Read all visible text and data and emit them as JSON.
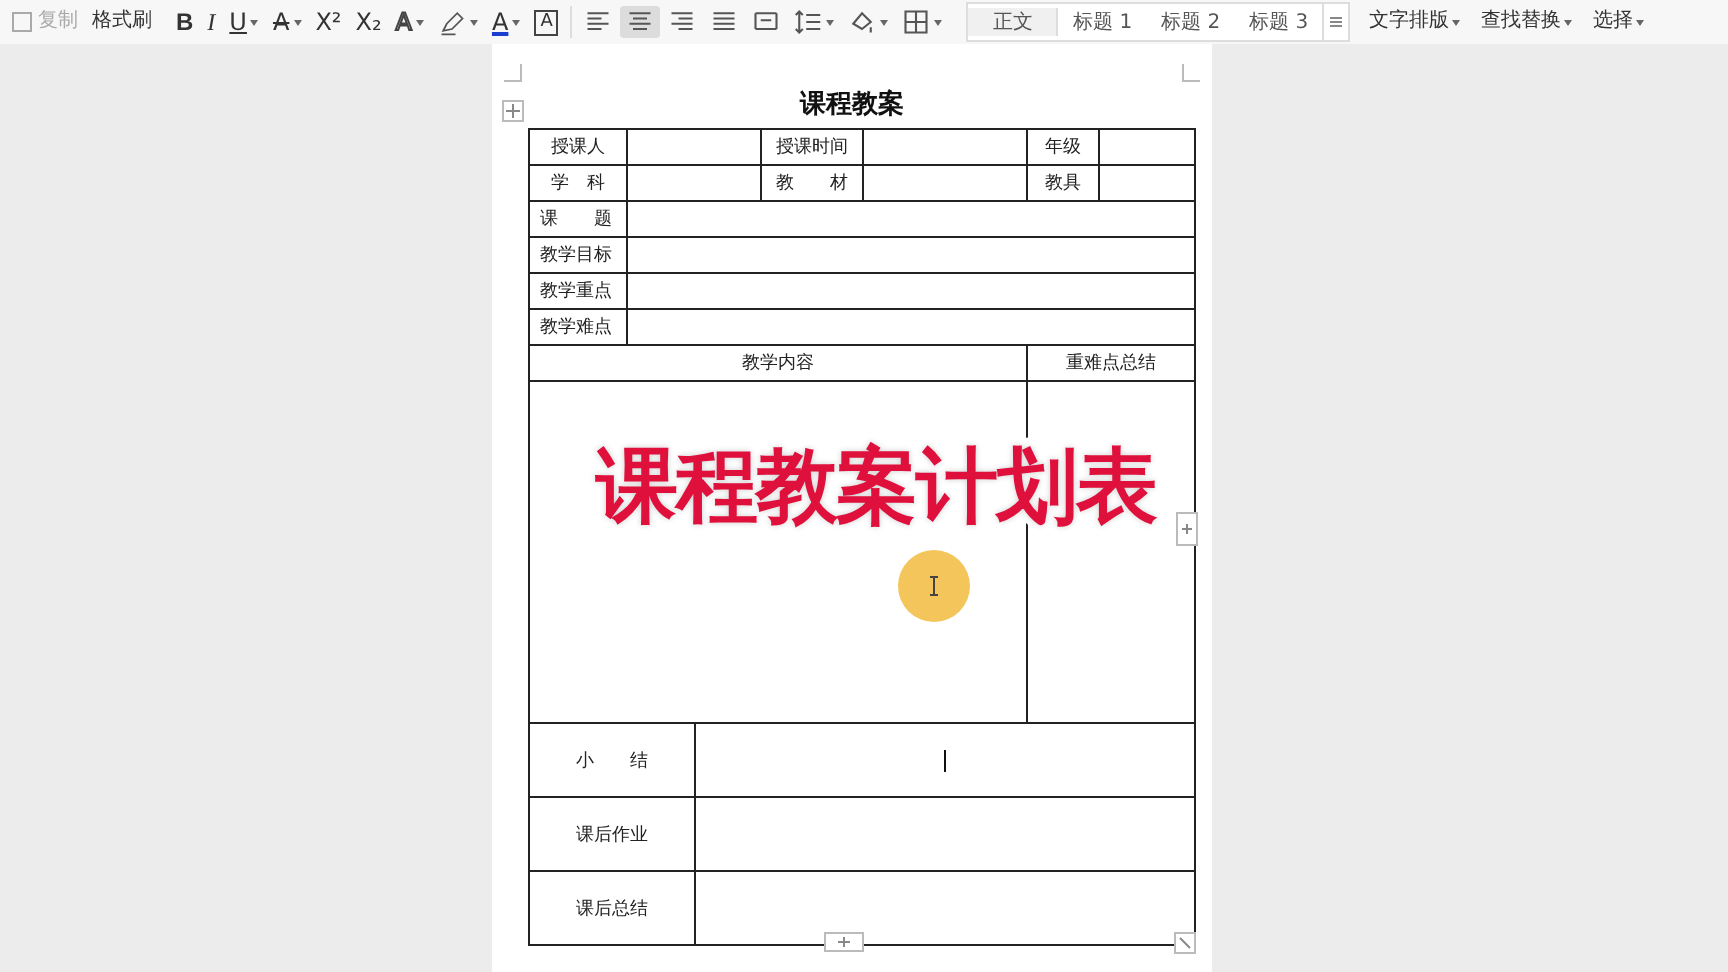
{
  "toolbar": {
    "clipboard": [
      {
        "label": "复制",
        "disabled": true
      },
      {
        "label": "格式刷",
        "disabled": false
      }
    ],
    "format": [
      {
        "kind": "bold",
        "label": "B",
        "dropdown": false
      },
      {
        "kind": "italic",
        "label": "I",
        "dropdown": false
      },
      {
        "kind": "underline",
        "label": "U",
        "dropdown": true
      },
      {
        "kind": "strike",
        "label": "A",
        "dropdown": true
      },
      {
        "kind": "sup",
        "label": "X²",
        "dropdown": false
      },
      {
        "kind": "sub",
        "label": "X₂",
        "dropdown": false
      },
      {
        "kind": "effect",
        "label": "A",
        "dropdown": true
      },
      {
        "kind": "highlight",
        "dropdown": true
      },
      {
        "kind": "color",
        "label": "A",
        "dropdown": true
      },
      {
        "kind": "boxed",
        "label": "A",
        "dropdown": false
      }
    ],
    "align": [
      {
        "kind": "left",
        "selected": false
      },
      {
        "kind": "center",
        "selected": true
      },
      {
        "kind": "right",
        "selected": false
      },
      {
        "kind": "justify",
        "selected": false
      },
      {
        "kind": "distribute",
        "selected": false
      },
      {
        "kind": "spacing",
        "selected": false,
        "dropdown": true
      },
      {
        "kind": "shading",
        "selected": false,
        "dropdown": true
      },
      {
        "kind": "borders",
        "selected": false,
        "dropdown": true
      }
    ],
    "styles": [
      {
        "label": "正文",
        "selected": true
      },
      {
        "label": "标题 1",
        "selected": false
      },
      {
        "label": "标题 2",
        "selected": false
      },
      {
        "label": "标题 3",
        "selected": false
      }
    ],
    "commands": [
      {
        "label": "文字排版",
        "dropdown": true
      },
      {
        "label": "查找替换",
        "dropdown": true
      },
      {
        "label": "选择",
        "dropdown": true
      }
    ]
  },
  "document": {
    "title": "课程教案",
    "rows": [
      {
        "kind": "pairs",
        "cells": [
          {
            "text": "授课人"
          },
          {},
          {
            "text": "授课时间"
          },
          {},
          {
            "text": "年级"
          },
          {}
        ]
      },
      {
        "kind": "pairs",
        "cells": [
          {
            "text": "学　科"
          },
          {},
          {
            "text": "教　　材"
          },
          {},
          {
            "text": "教具"
          },
          {}
        ]
      },
      {
        "kind": "field",
        "cells": [
          {
            "text": "课　　题"
          },
          {}
        ]
      },
      {
        "kind": "field",
        "cells": [
          {
            "text": "教学目标"
          },
          {}
        ]
      },
      {
        "kind": "field",
        "cells": [
          {
            "text": "教学重点"
          },
          {}
        ]
      },
      {
        "kind": "field",
        "cells": [
          {
            "text": "教学难点"
          },
          {}
        ]
      },
      {
        "kind": "header",
        "cells": [
          {
            "text": "教学内容"
          },
          {
            "text": "重难点总结"
          }
        ]
      },
      {
        "kind": "content",
        "cells": [
          {},
          {}
        ]
      },
      {
        "kind": "summary",
        "cells": [
          {
            "text": "小　　结"
          },
          {
            "caret": true
          }
        ]
      },
      {
        "kind": "summary",
        "cells": [
          {
            "text": "课后作业"
          },
          {}
        ]
      },
      {
        "kind": "summary",
        "cells": [
          {
            "text": "课后总结"
          },
          {}
        ]
      }
    ]
  },
  "overlay_caption": "课程教案计划表"
}
